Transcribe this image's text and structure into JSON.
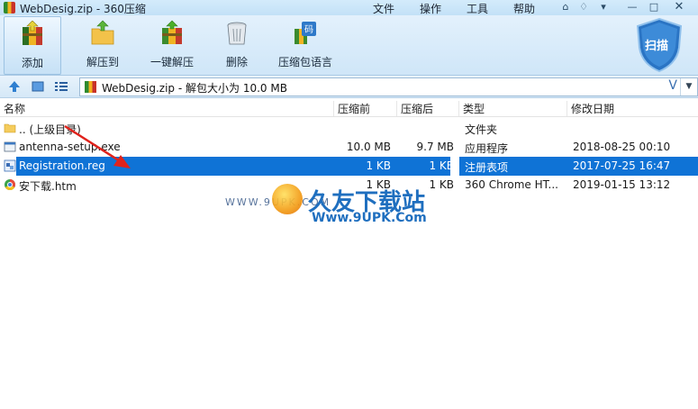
{
  "window": {
    "title": "WebDesig.zip - 360压缩",
    "menus": [
      "文件",
      "操作",
      "工具",
      "帮助"
    ]
  },
  "toolbar": {
    "buttons": [
      {
        "label": "添加",
        "icon": "add-archive-icon"
      },
      {
        "label": "解压到",
        "icon": "extract-to-icon"
      },
      {
        "label": "一键解压",
        "icon": "one-click-extract-icon"
      },
      {
        "label": "删除",
        "icon": "trash-icon"
      },
      {
        "label": "压缩包语言",
        "icon": "archive-language-icon"
      }
    ],
    "scan_label": "扫描"
  },
  "address": {
    "path": "WebDesig.zip - 解包大小为 10.0 MB",
    "v_label": "V"
  },
  "columns": {
    "name": "名称",
    "before": "压缩前",
    "after": "压缩后",
    "type": "类型",
    "modified": "修改日期"
  },
  "files": [
    {
      "name": ".. (上级目录)",
      "before": "",
      "after": "",
      "type": "文件夹",
      "modified": "",
      "icon": "folder-icon"
    },
    {
      "name": "antenna-setup.exe",
      "before": "10.0 MB",
      "after": "9.7 MB",
      "type": "应用程序",
      "modified": "2018-08-25 00:10",
      "icon": "exe-icon"
    },
    {
      "name": "Registration.reg",
      "before": "1 KB",
      "after": "1 KB",
      "type": "注册表项",
      "modified": "2017-07-25 16:47",
      "icon": "reg-icon"
    },
    {
      "name": "安下载.htm",
      "before": "1 KB",
      "after": "1 KB",
      "type": "360 Chrome HT...",
      "modified": "2019-01-15 13:12",
      "icon": "html-icon"
    }
  ],
  "watermark": {
    "url_small": "WWW.9UPK.COM",
    "text_cn": "久友下载站",
    "url_large": "Www.9UPK.Com"
  },
  "colors": {
    "selection": "#0f73d6",
    "toolbar_bg": "#d8ecfa",
    "arrow": "#e0231c"
  }
}
